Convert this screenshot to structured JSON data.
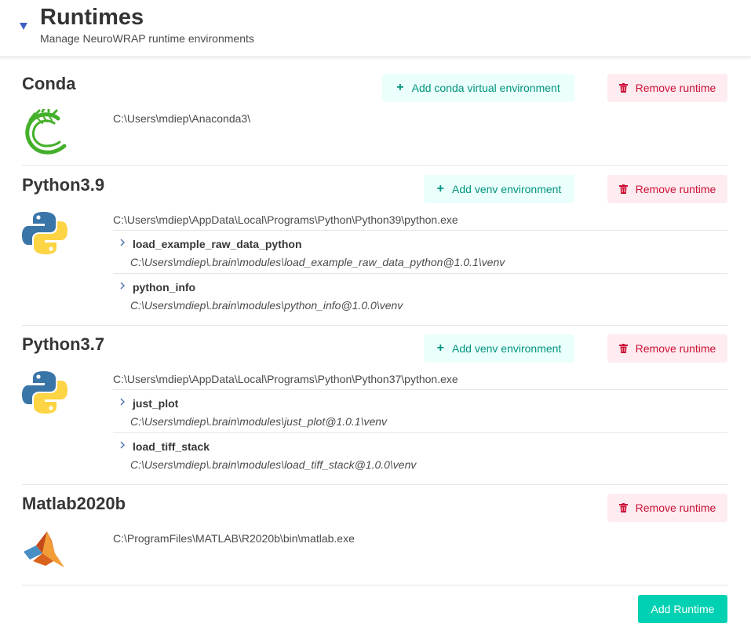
{
  "header": {
    "title": "Runtimes",
    "subtitle": "Manage NeuroWRAP runtime environments",
    "caret_icon": "triangle-down-icon"
  },
  "colors": {
    "primary": "#00d1b2",
    "add_bg": "#ebfffc",
    "add_text": "#00947e",
    "remove_bg": "#feecf0",
    "remove_text": "#cc0f35",
    "caret": "#3e5fc4"
  },
  "runtimes": [
    {
      "name": "Conda",
      "path": "C:\\Users\\mdiep\\Anaconda3\\",
      "logo": "conda-logo-icon",
      "add_label": "Add conda virtual environment",
      "remove_label": "Remove runtime",
      "environments": []
    },
    {
      "name": "Python3.9",
      "path": "C:\\Users\\mdiep\\AppData\\Local\\Programs\\Python\\Python39\\python.exe",
      "logo": "python-logo-icon",
      "add_label": "Add venv environment",
      "remove_label": "Remove runtime",
      "environments": [
        {
          "name": "load_example_raw_data_python",
          "path": "C:\\Users\\mdiep\\.brain\\modules\\load_example_raw_data_python@1.0.1\\venv"
        },
        {
          "name": "python_info",
          "path": "C:\\Users\\mdiep\\.brain\\modules\\python_info@1.0.0\\venv"
        }
      ]
    },
    {
      "name": "Python3.7",
      "path": "C:\\Users\\mdiep\\AppData\\Local\\Programs\\Python\\Python37\\python.exe",
      "logo": "python-logo-icon",
      "add_label": "Add venv environment",
      "remove_label": "Remove runtime",
      "environments": [
        {
          "name": "just_plot",
          "path": "C:\\Users\\mdiep\\.brain\\modules\\just_plot@1.0.1\\venv"
        },
        {
          "name": "load_tiff_stack",
          "path": "C:\\Users\\mdiep\\.brain\\modules\\load_tiff_stack@1.0.0\\venv"
        }
      ]
    },
    {
      "name": "Matlab2020b",
      "path": "C:\\ProgramFiles\\MATLAB\\R2020b\\bin\\matlab.exe",
      "logo": "matlab-logo-icon",
      "remove_label": "Remove runtime",
      "environments": []
    }
  ],
  "footer": {
    "add_runtime_label": "Add Runtime"
  },
  "icons": {
    "add": "plus-icon",
    "remove": "trash-icon",
    "expand": "chevron-right-icon"
  }
}
